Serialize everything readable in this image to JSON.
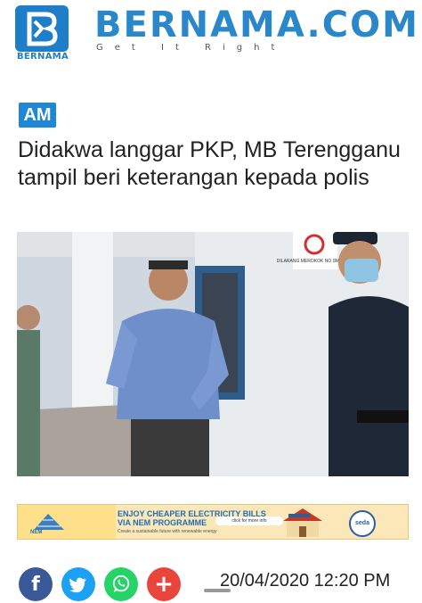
{
  "header": {
    "logo_text": "BERNAMA",
    "brand_title": "BERNAMA.COM",
    "tagline": "Get It Right"
  },
  "article": {
    "category_badge": "AM",
    "headline": "Didakwa langgar PKP, MB Terengganu tampil beri keterangan kepada polis",
    "datetime": "20/04/2020 12:20 PM"
  },
  "photo": {
    "sign_text": "DILARANG MEROKOK NO SMOKING"
  },
  "ad": {
    "line1": "ENJOY CHEAPER ELECTRICITY BILLS",
    "line2": "VIA NEM PROGRAMME",
    "line3": "Create a sustainable future with renewable energy",
    "button": "click for more info",
    "logo_left": "NEM",
    "logo_right": "seda"
  },
  "share": {
    "facebook_glyph": "f",
    "plus_glyph": "+"
  },
  "icons": [
    "bernama-logo-icon",
    "facebook-icon",
    "twitter-icon",
    "whatsapp-icon",
    "more-share-icon"
  ],
  "colors": {
    "brand_blue": "#2a87c9",
    "badge_blue": "#1e88d6",
    "facebook": "#3b5998",
    "twitter": "#1da1f2",
    "whatsapp": "#25d366",
    "more": "#e8453c"
  }
}
